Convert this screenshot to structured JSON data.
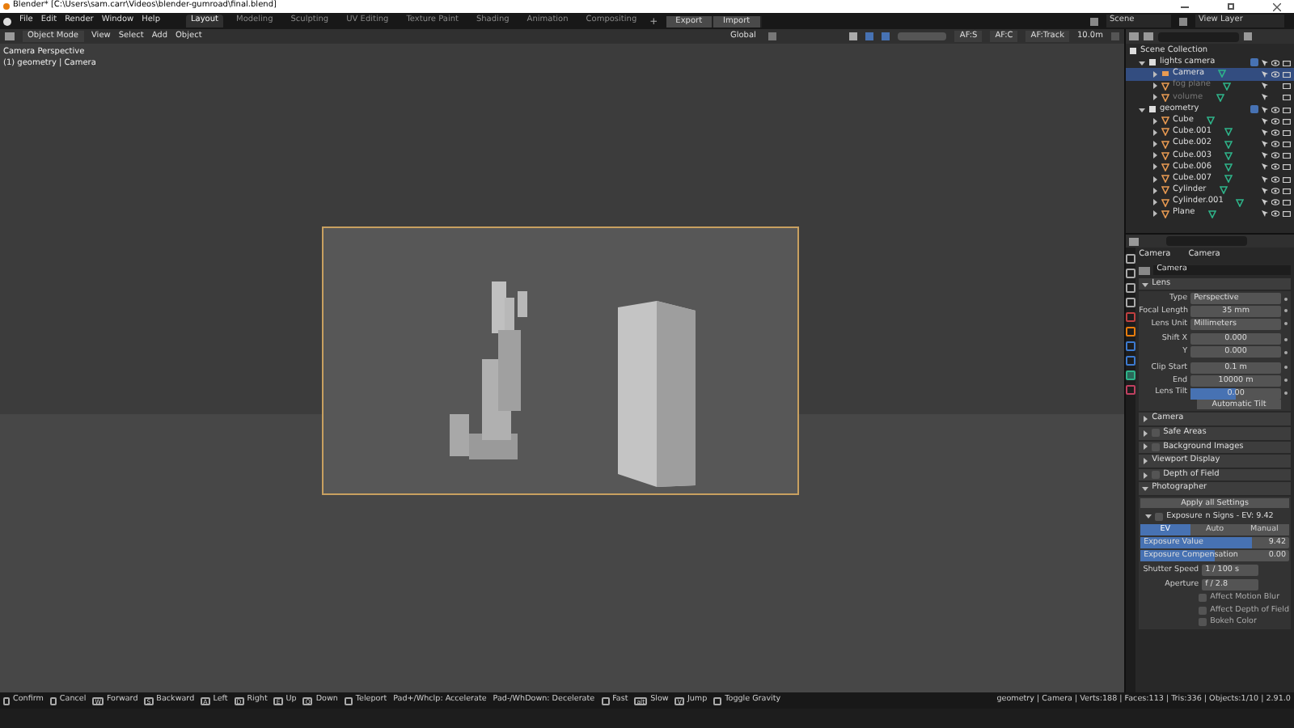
{
  "window": {
    "title": "Blender* [C:\\Users\\sam.carr\\Videos\\blender-gumroad\\final.blend]"
  },
  "menu": [
    "File",
    "Edit",
    "Render",
    "Window",
    "Help"
  ],
  "workspaces": [
    {
      "label": "Layout",
      "selected": true
    },
    {
      "label": "Modeling",
      "selected": false
    },
    {
      "label": "Sculpting",
      "selected": false
    },
    {
      "label": "UV Editing",
      "selected": false
    },
    {
      "label": "Texture Paint",
      "selected": false
    },
    {
      "label": "Shading",
      "selected": false
    },
    {
      "label": "Animation",
      "selected": false
    },
    {
      "label": "Compositing",
      "selected": false
    }
  ],
  "add_workspace": "+",
  "top_buttons": [
    "Export",
    "Import"
  ],
  "scene": "Scene",
  "view_layer": "View Layer",
  "header": {
    "mode": "Object Mode",
    "menus": [
      "View",
      "Select",
      "Add",
      "Object"
    ],
    "orientation": "Global",
    "af_buttons": [
      "AF:S",
      "AF:C",
      "AF:Track"
    ],
    "distance": "10.0m"
  },
  "viewport": {
    "overlay": [
      "Camera Perspective",
      "(1) geometry | Camera"
    ]
  },
  "outliner": {
    "root": "Scene Collection",
    "children": [
      {
        "name": "lights camera",
        "kind": "collection",
        "checked": true,
        "children": [
          {
            "name": "Camera",
            "kind": "camera",
            "selected": true,
            "disabled": false
          },
          {
            "name": "fog plane",
            "kind": "mesh",
            "selected": false,
            "disabled": true
          },
          {
            "name": "volume",
            "kind": "mesh",
            "selected": false,
            "disabled": true
          }
        ]
      },
      {
        "name": "geometry",
        "kind": "collection",
        "checked": true,
        "children": [
          {
            "name": "Cube",
            "kind": "mesh",
            "selected": false,
            "disabled": false
          },
          {
            "name": "Cube.001",
            "kind": "mesh",
            "selected": false,
            "disabled": false
          },
          {
            "name": "Cube.002",
            "kind": "mesh",
            "selected": false,
            "disabled": false
          },
          {
            "name": "Cube.003",
            "kind": "mesh",
            "selected": false,
            "disabled": false
          },
          {
            "name": "Cube.006",
            "kind": "mesh",
            "selected": false,
            "disabled": false
          },
          {
            "name": "Cube.007",
            "kind": "mesh",
            "selected": false,
            "disabled": false
          },
          {
            "name": "Cylinder",
            "kind": "mesh",
            "selected": false,
            "disabled": false
          },
          {
            "name": "Cylinder.001",
            "kind": "mesh",
            "selected": false,
            "disabled": false
          },
          {
            "name": "Plane",
            "kind": "mesh",
            "selected": false,
            "disabled": false
          }
        ]
      }
    ]
  },
  "properties": {
    "breadcrumb": [
      "Camera",
      "Camera"
    ],
    "data_name": "Camera",
    "lens": {
      "title": "Lens",
      "expanded": true,
      "fields": [
        {
          "label": "Type",
          "value": "Perspective",
          "kind": "dropdown"
        },
        {
          "label": "Focal Length",
          "value": "35 mm",
          "kind": "number"
        },
        {
          "label": "Lens Unit",
          "value": "Millimeters",
          "kind": "dropdown"
        },
        {
          "label": "Shift X",
          "value": "0.000",
          "kind": "number"
        },
        {
          "label": "Y",
          "value": "0.000",
          "kind": "number"
        },
        {
          "label": "Clip Start",
          "value": "0.1 m",
          "kind": "number"
        },
        {
          "label": "End",
          "value": "10000 m",
          "kind": "number"
        },
        {
          "label": "Lens Tilt",
          "value": "0.00",
          "kind": "slider",
          "level": 0.5
        }
      ],
      "button": "Automatic Tilt"
    },
    "panels": [
      {
        "title": "Camera",
        "kind": "plain",
        "expanded": false
      },
      {
        "title": "Safe Areas",
        "kind": "checkbox",
        "checked": false,
        "expanded": false
      },
      {
        "title": "Background Images",
        "kind": "checkbox",
        "checked": false,
        "expanded": false
      },
      {
        "title": "Viewport Display",
        "kind": "plain",
        "expanded": false
      },
      {
        "title": "Depth of Field",
        "kind": "checkbox",
        "checked": false,
        "expanded": false
      },
      {
        "title": "Photographer",
        "kind": "plain",
        "expanded": true
      }
    ],
    "photographer": {
      "apply": "Apply all Settings",
      "exposure": {
        "label": "Exposure",
        "extra": "n Signs - EV: 9.42",
        "checked": false
      },
      "modes": [
        {
          "label": "EV",
          "selected": true
        },
        {
          "label": "Auto",
          "selected": false
        },
        {
          "label": "Manual",
          "selected": false
        }
      ],
      "sliders": [
        {
          "label": "Exposure Value",
          "reading": "9.42",
          "level": 0.75
        },
        {
          "label": "Exposure Compensation",
          "reading": "0.00",
          "level": 0.5
        }
      ],
      "fields": [
        {
          "label": "Shutter Speed",
          "value": "1 / 100 s"
        },
        {
          "label": "Aperture",
          "value": "f / 2.8"
        }
      ],
      "checks": [
        {
          "label": "Affect Motion Blur",
          "checked": false
        },
        {
          "label": "Affect Depth of Field",
          "checked": false
        },
        {
          "label": "Bokeh Color",
          "checked": false
        }
      ]
    }
  },
  "status_bar": {
    "hints": [
      {
        "action": "Confirm",
        "kind": "mouse"
      },
      {
        "action": "Cancel",
        "kind": "mouse"
      },
      {
        "key": "W",
        "action": "Forward",
        "kind": "key"
      },
      {
        "key": "S",
        "action": "Backward",
        "kind": "key"
      },
      {
        "key": "A",
        "action": "Left",
        "kind": "key"
      },
      {
        "key": "D",
        "action": "Right",
        "kind": "key"
      },
      {
        "key": "E",
        "action": "Up",
        "kind": "key"
      },
      {
        "key": "Q",
        "action": "Down",
        "kind": "key"
      },
      {
        "action": "Teleport",
        "kind": "key"
      },
      {
        "action": "Pad+/Whclp: Accelerate",
        "kind": "text"
      },
      {
        "action": "Pad-/WhDown: Decelerate",
        "kind": "text"
      },
      {
        "action": "Fast",
        "kind": "key"
      },
      {
        "key": "alt",
        "action": "Slow",
        "kind": "key"
      },
      {
        "key": "V",
        "action": "Jump",
        "kind": "key"
      },
      {
        "action": "Toggle Gravity",
        "kind": "key"
      }
    ],
    "stats": "geometry | Camera | Verts:188 | Faces:113 | Tris:336 | Objects:1/10 | 2.91.0"
  }
}
